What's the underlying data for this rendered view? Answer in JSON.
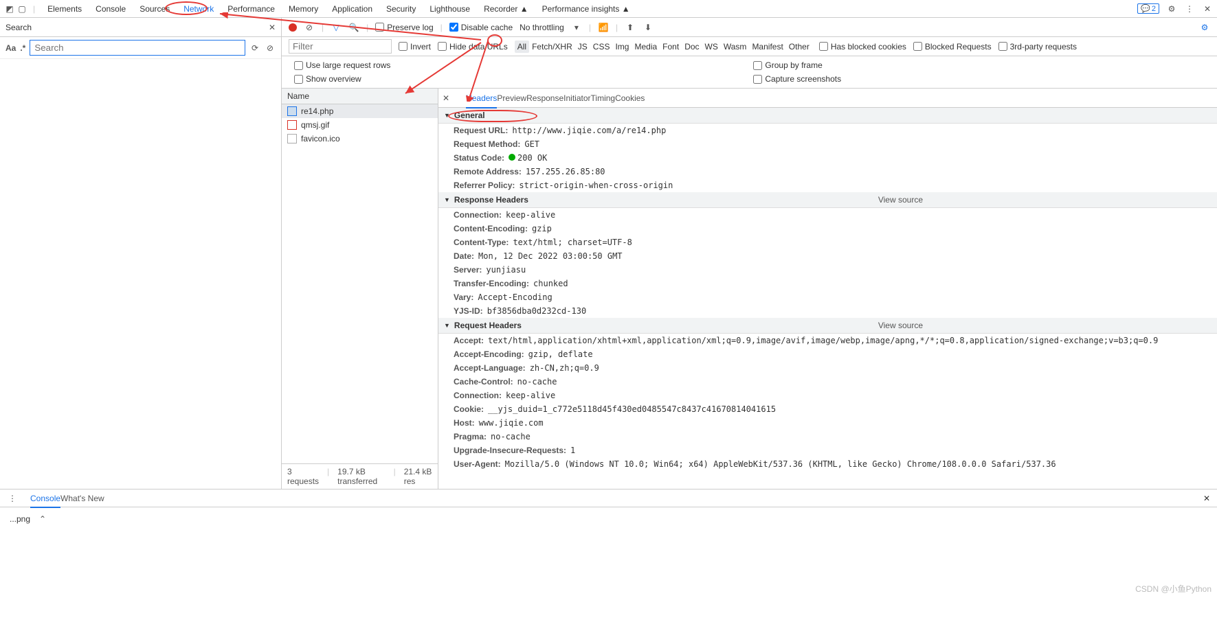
{
  "topTabs": {
    "items": [
      "Elements",
      "Console",
      "Sources",
      "Network",
      "Performance",
      "Memory",
      "Application",
      "Security",
      "Lighthouse",
      "Recorder ▲",
      "Performance insights ▲"
    ],
    "activeIndex": 3,
    "issuesCount": "2"
  },
  "searchPanel": {
    "title": "Search",
    "placeholder": "Search",
    "aa": "Aa",
    "regex": ".*"
  },
  "netToolbar": {
    "preserveLog": "Preserve log",
    "disableCache": "Disable cache",
    "throttling": "No throttling"
  },
  "filterBar": {
    "placeholder": "Filter",
    "invert": "Invert",
    "hideData": "Hide data URLs",
    "types": [
      "All",
      "Fetch/XHR",
      "JS",
      "CSS",
      "Img",
      "Media",
      "Font",
      "Doc",
      "WS",
      "Wasm",
      "Manifest",
      "Other"
    ],
    "activeType": 0,
    "hasBlocked": "Has blocked cookies",
    "blockedReq": "Blocked Requests",
    "thirdParty": "3rd-party requests"
  },
  "options": {
    "largeRows": "Use large request rows",
    "showOverview": "Show overview",
    "groupFrame": "Group by frame",
    "capture": "Capture screenshots"
  },
  "reqList": {
    "header": "Name",
    "items": [
      {
        "name": "re14.php",
        "cls": "php",
        "sel": true
      },
      {
        "name": "qmsj.gif",
        "cls": "gif",
        "sel": false
      },
      {
        "name": "favicon.ico",
        "cls": "",
        "sel": false
      }
    ]
  },
  "detailTabs": [
    "Headers",
    "Preview",
    "Response",
    "Initiator",
    "Timing",
    "Cookies"
  ],
  "detailActive": 0,
  "sections": {
    "general": {
      "title": "General",
      "rows": [
        {
          "k": "Request URL:",
          "v": "http://www.jiqie.com/a/re14.php"
        },
        {
          "k": "Request Method:",
          "v": "GET"
        },
        {
          "k": "Status Code:",
          "v": "200 OK",
          "status": true
        },
        {
          "k": "Remote Address:",
          "v": "157.255.26.85:80"
        },
        {
          "k": "Referrer Policy:",
          "v": "strict-origin-when-cross-origin"
        }
      ]
    },
    "response": {
      "title": "Response Headers",
      "viewSource": "View source",
      "rows": [
        {
          "k": "Connection:",
          "v": "keep-alive"
        },
        {
          "k": "Content-Encoding:",
          "v": "gzip"
        },
        {
          "k": "Content-Type:",
          "v": "text/html; charset=UTF-8"
        },
        {
          "k": "Date:",
          "v": "Mon, 12 Dec 2022 03:00:50 GMT"
        },
        {
          "k": "Server:",
          "v": "yunjiasu"
        },
        {
          "k": "Transfer-Encoding:",
          "v": "chunked"
        },
        {
          "k": "Vary:",
          "v": "Accept-Encoding"
        },
        {
          "k": "YJS-ID:",
          "v": "bf3856dba0d232cd-130"
        }
      ]
    },
    "request": {
      "title": "Request Headers",
      "viewSource": "View source",
      "rows": [
        {
          "k": "Accept:",
          "v": "text/html,application/xhtml+xml,application/xml;q=0.9,image/avif,image/webp,image/apng,*/*;q=0.8,application/signed-exchange;v=b3;q=0.9"
        },
        {
          "k": "Accept-Encoding:",
          "v": "gzip, deflate"
        },
        {
          "k": "Accept-Language:",
          "v": "zh-CN,zh;q=0.9"
        },
        {
          "k": "Cache-Control:",
          "v": "no-cache"
        },
        {
          "k": "Connection:",
          "v": "keep-alive"
        },
        {
          "k": "Cookie:",
          "v": "__yjs_duid=1_c772e5118d45f430ed0485547c8437c41670814041615"
        },
        {
          "k": "Host:",
          "v": "www.jiqie.com"
        },
        {
          "k": "Pragma:",
          "v": "no-cache"
        },
        {
          "k": "Upgrade-Insecure-Requests:",
          "v": "1"
        },
        {
          "k": "User-Agent:",
          "v": "Mozilla/5.0 (Windows NT 10.0; Win64; x64) AppleWebKit/537.36 (KHTML, like Gecko) Chrome/108.0.0.0 Safari/537.36"
        }
      ]
    }
  },
  "status": {
    "requests": "3 requests",
    "transferred": "19.7 kB transferred",
    "resources": "21.4 kB res"
  },
  "bottomDrawer": {
    "tabs": [
      "Console",
      "What's New"
    ],
    "active": 0
  },
  "downloadBar": {
    "file": "...png"
  },
  "watermark": "CSDN @小鱼Python"
}
